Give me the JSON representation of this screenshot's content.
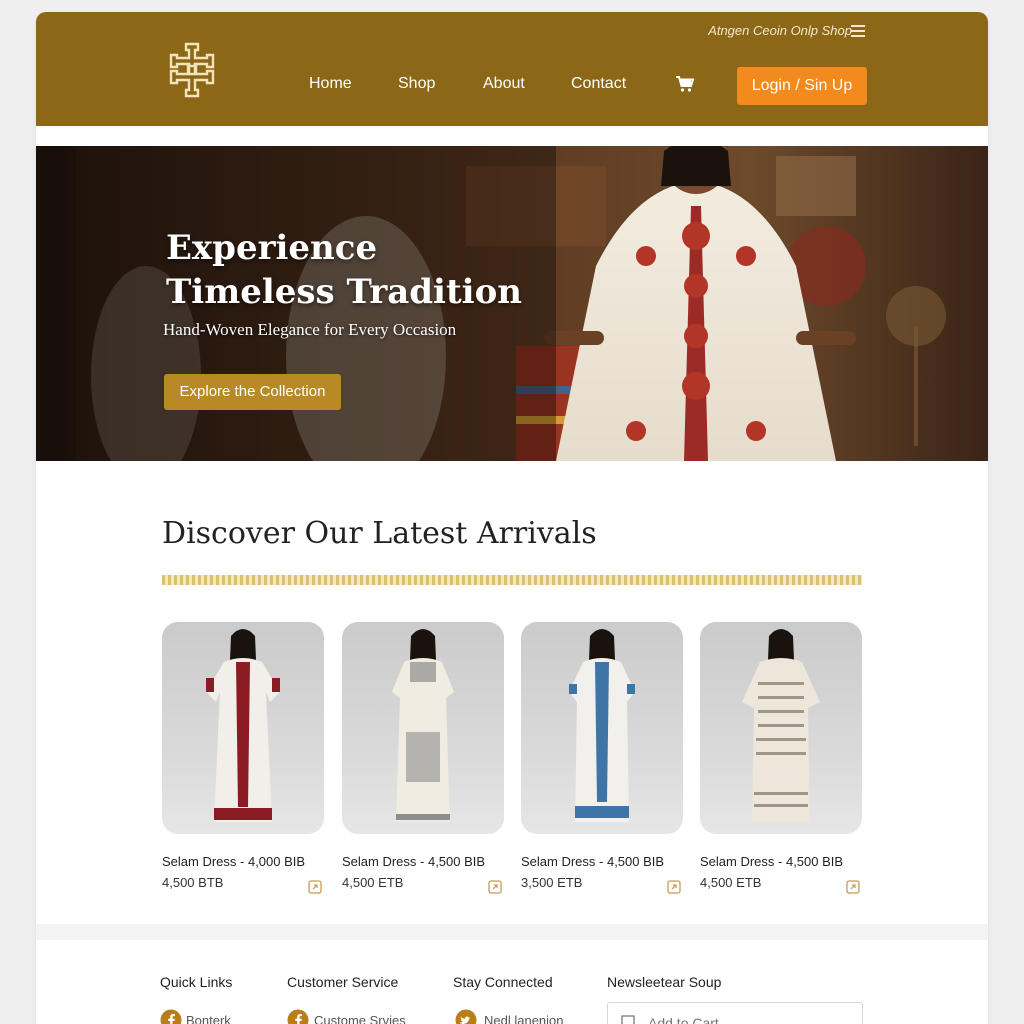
{
  "colors": {
    "header_bg": "#8c6718",
    "login_button": "#f28a1e",
    "hero_button": "#b78a25",
    "facebook_icon": "#b97d1a"
  },
  "header": {
    "top_text": "Atngen Ceoin Onlp Shop",
    "nav": [
      "Home",
      "Shop",
      "About",
      "Contact"
    ],
    "login_label": "Login / Sin Up",
    "cart_icon": "cart-icon",
    "menu_icon": "hamburger-icon",
    "logo_icon": "ethiopian-cross-icon"
  },
  "hero": {
    "title_line1": "Experience",
    "title_line2": "Timeless Tradition",
    "subtitle": "Hand-Woven Elegance for Every Occasion",
    "cta": "Explore the Collection"
  },
  "arrivals": {
    "title": "Discover Our Latest Arrivals",
    "products": [
      {
        "name": "Selam Dress - 4,000 BIB",
        "price": "4,500 BTB",
        "dress_color": "#8c1c24"
      },
      {
        "name": "Selam Dress - 4,500 BIB",
        "price": "4,500 ETB",
        "dress_color": "#8d8d8d"
      },
      {
        "name": "Selam Dress - 4,500 BIB",
        "price": "3,500 ETB",
        "dress_color": "#3f74a6"
      },
      {
        "name": "Selam Dress - 4,500 BIB",
        "price": "4,500 ETB",
        "dress_color": "#a39585"
      }
    ]
  },
  "footer": {
    "quick_links": "Quick Links",
    "customer_service": "Customer Service",
    "stay_connected": "Stay Connected",
    "newsletter": "Newsleetear Soup",
    "link1": "Bonterk",
    "link2": "Custome Srvies",
    "link3": "Nedl lanenion",
    "newsletter_placeholder": "Add to Cart"
  }
}
